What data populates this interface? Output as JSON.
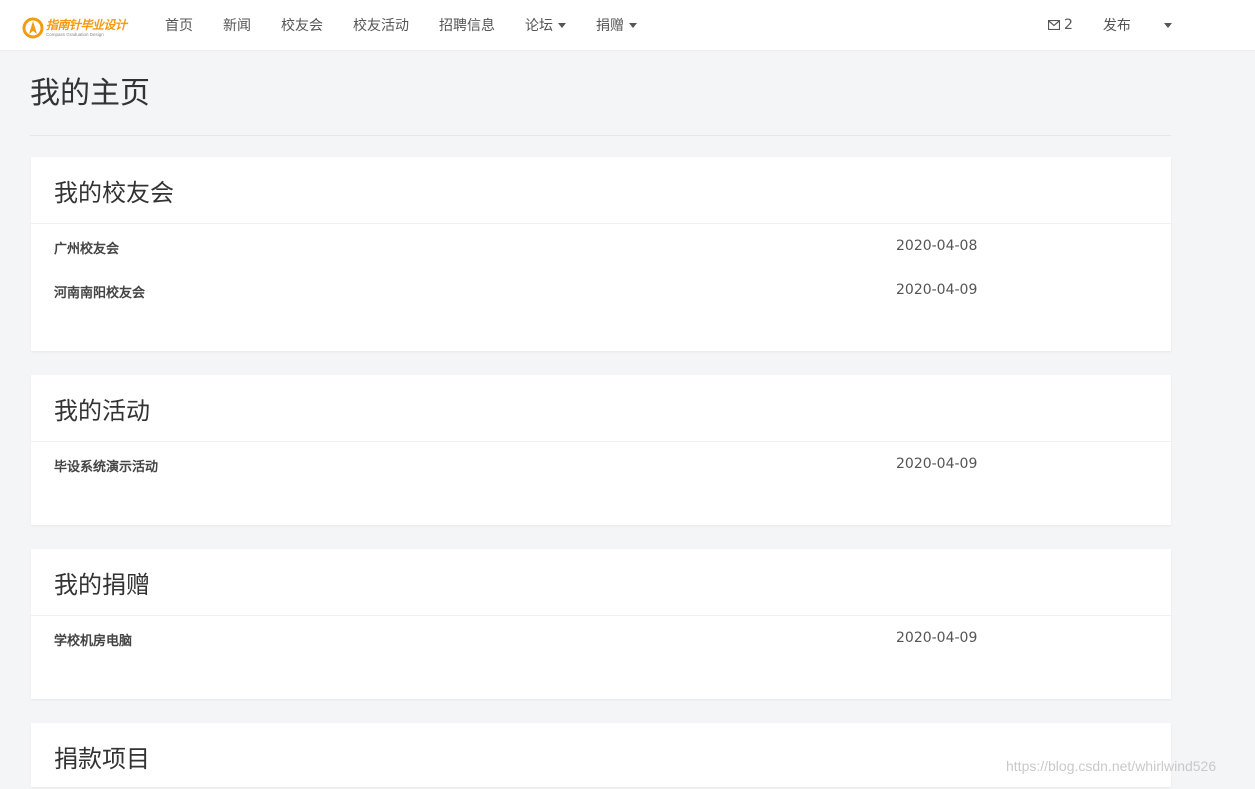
{
  "logo": {
    "name_cn": "指南针毕业设计",
    "name_en": "Compass Graduation Design"
  },
  "nav": {
    "items": [
      {
        "label": "首页"
      },
      {
        "label": "新闻"
      },
      {
        "label": "校友会"
      },
      {
        "label": "校友活动"
      },
      {
        "label": "招聘信息"
      },
      {
        "label": "论坛"
      },
      {
        "label": "捐赠"
      }
    ],
    "mail_count": "2",
    "publish_label": "发布"
  },
  "page": {
    "title": "我的主页"
  },
  "sections": {
    "alumni": {
      "title": "我的校友会",
      "rows": [
        {
          "name": "广州校友会",
          "date": "2020-04-08"
        },
        {
          "name": "河南南阳校友会",
          "date": "2020-04-09"
        }
      ]
    },
    "activities": {
      "title": "我的活动",
      "rows": [
        {
          "name": "毕设系统演示活动",
          "date": "2020-04-09"
        }
      ]
    },
    "donations": {
      "title": "我的捐赠",
      "rows": [
        {
          "name": "学校机房电脑",
          "date": "2020-04-09"
        }
      ]
    },
    "projects": {
      "title": "捐款项目"
    }
  },
  "watermark": "https://blog.csdn.net/whirlwind526",
  "colors": {
    "logo_orange": "#f39c12",
    "background": "#f4f5f7"
  }
}
